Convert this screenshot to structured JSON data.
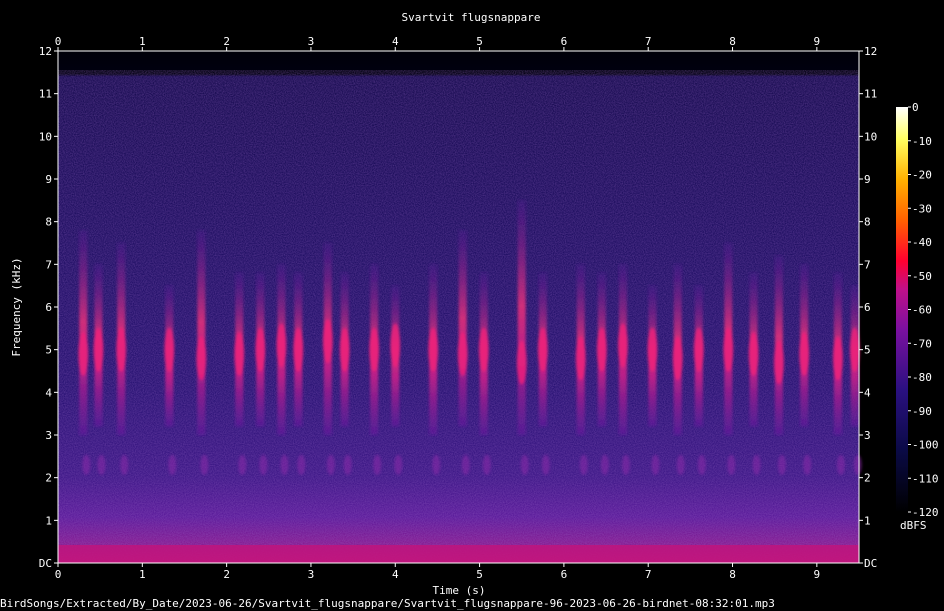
{
  "colors": {
    "background": "#000000",
    "text": "#ffffff"
  },
  "chart_data": {
    "type": "heatmap",
    "title": "Svartvit flugsnappare",
    "xlabel": "Time (s)",
    "ylabel": "Frequency (kHz)",
    "x_ticks": [
      "0",
      "1",
      "2",
      "3",
      "4",
      "5",
      "6",
      "7",
      "8",
      "9"
    ],
    "y_ticks": [
      "DC",
      "1",
      "2",
      "3",
      "4",
      "5",
      "6",
      "7",
      "8",
      "9",
      "10",
      "11",
      "12"
    ],
    "xlim": [
      0,
      9.5
    ],
    "ylim": [
      0,
      12
    ],
    "colorbar": {
      "label": "dBFS",
      "ticks": [
        "0",
        "-10",
        "-20",
        "-30",
        "-40",
        "-50",
        "-60",
        "-70",
        "-80",
        "-90",
        "-100",
        "-110",
        "-120"
      ],
      "range": [
        -120,
        0
      ]
    },
    "calls": [
      {
        "t": 0.3,
        "lo": 3.0,
        "hi": 7.8,
        "peak": 4.9
      },
      {
        "t": 0.48,
        "lo": 3.2,
        "hi": 7.0,
        "peak": 5.0
      },
      {
        "t": 0.75,
        "lo": 3.0,
        "hi": 7.5,
        "peak": 5.0
      },
      {
        "t": 1.32,
        "lo": 3.2,
        "hi": 6.5,
        "peak": 5.0
      },
      {
        "t": 1.7,
        "lo": 3.0,
        "hi": 7.8,
        "peak": 4.8
      },
      {
        "t": 2.15,
        "lo": 3.2,
        "hi": 6.8,
        "peak": 4.9
      },
      {
        "t": 2.4,
        "lo": 3.2,
        "hi": 6.8,
        "peak": 5.0
      },
      {
        "t": 2.65,
        "lo": 3.0,
        "hi": 7.0,
        "peak": 5.1
      },
      {
        "t": 2.85,
        "lo": 3.2,
        "hi": 6.8,
        "peak": 5.0
      },
      {
        "t": 3.2,
        "lo": 3.0,
        "hi": 7.5,
        "peak": 5.2
      },
      {
        "t": 3.4,
        "lo": 3.2,
        "hi": 6.8,
        "peak": 5.0
      },
      {
        "t": 3.75,
        "lo": 3.0,
        "hi": 7.0,
        "peak": 5.0
      },
      {
        "t": 4.0,
        "lo": 3.2,
        "hi": 6.5,
        "peak": 5.1
      },
      {
        "t": 4.45,
        "lo": 3.0,
        "hi": 7.0,
        "peak": 5.0
      },
      {
        "t": 4.8,
        "lo": 3.2,
        "hi": 7.8,
        "peak": 4.9
      },
      {
        "t": 5.05,
        "lo": 3.0,
        "hi": 6.8,
        "peak": 5.0
      },
      {
        "t": 5.5,
        "lo": 3.0,
        "hi": 8.5,
        "peak": 4.7
      },
      {
        "t": 5.75,
        "lo": 3.2,
        "hi": 6.8,
        "peak": 5.0
      },
      {
        "t": 6.2,
        "lo": 3.0,
        "hi": 7.0,
        "peak": 4.8
      },
      {
        "t": 6.45,
        "lo": 3.2,
        "hi": 6.8,
        "peak": 5.0
      },
      {
        "t": 6.7,
        "lo": 3.0,
        "hi": 7.0,
        "peak": 5.1
      },
      {
        "t": 7.05,
        "lo": 3.2,
        "hi": 6.5,
        "peak": 5.0
      },
      {
        "t": 7.35,
        "lo": 3.0,
        "hi": 7.0,
        "peak": 4.8
      },
      {
        "t": 7.6,
        "lo": 3.2,
        "hi": 6.5,
        "peak": 5.0
      },
      {
        "t": 7.95,
        "lo": 3.0,
        "hi": 7.5,
        "peak": 5.0
      },
      {
        "t": 8.25,
        "lo": 3.2,
        "hi": 6.8,
        "peak": 4.9
      },
      {
        "t": 8.55,
        "lo": 3.0,
        "hi": 7.2,
        "peak": 4.7
      },
      {
        "t": 8.85,
        "lo": 3.2,
        "hi": 7.0,
        "peak": 4.9
      },
      {
        "t": 9.25,
        "lo": 3.0,
        "hi": 6.8,
        "peak": 4.8
      },
      {
        "t": 9.45,
        "lo": 3.2,
        "hi": 6.5,
        "peak": 5.0
      }
    ]
  },
  "footer": {
    "path": "BirdSongs/Extracted/By_Date/2023-06-26/Svartvit_flugsnappare/Svartvit_flugsnappare-96-2023-06-26-birdnet-08:32:01.mp3"
  }
}
